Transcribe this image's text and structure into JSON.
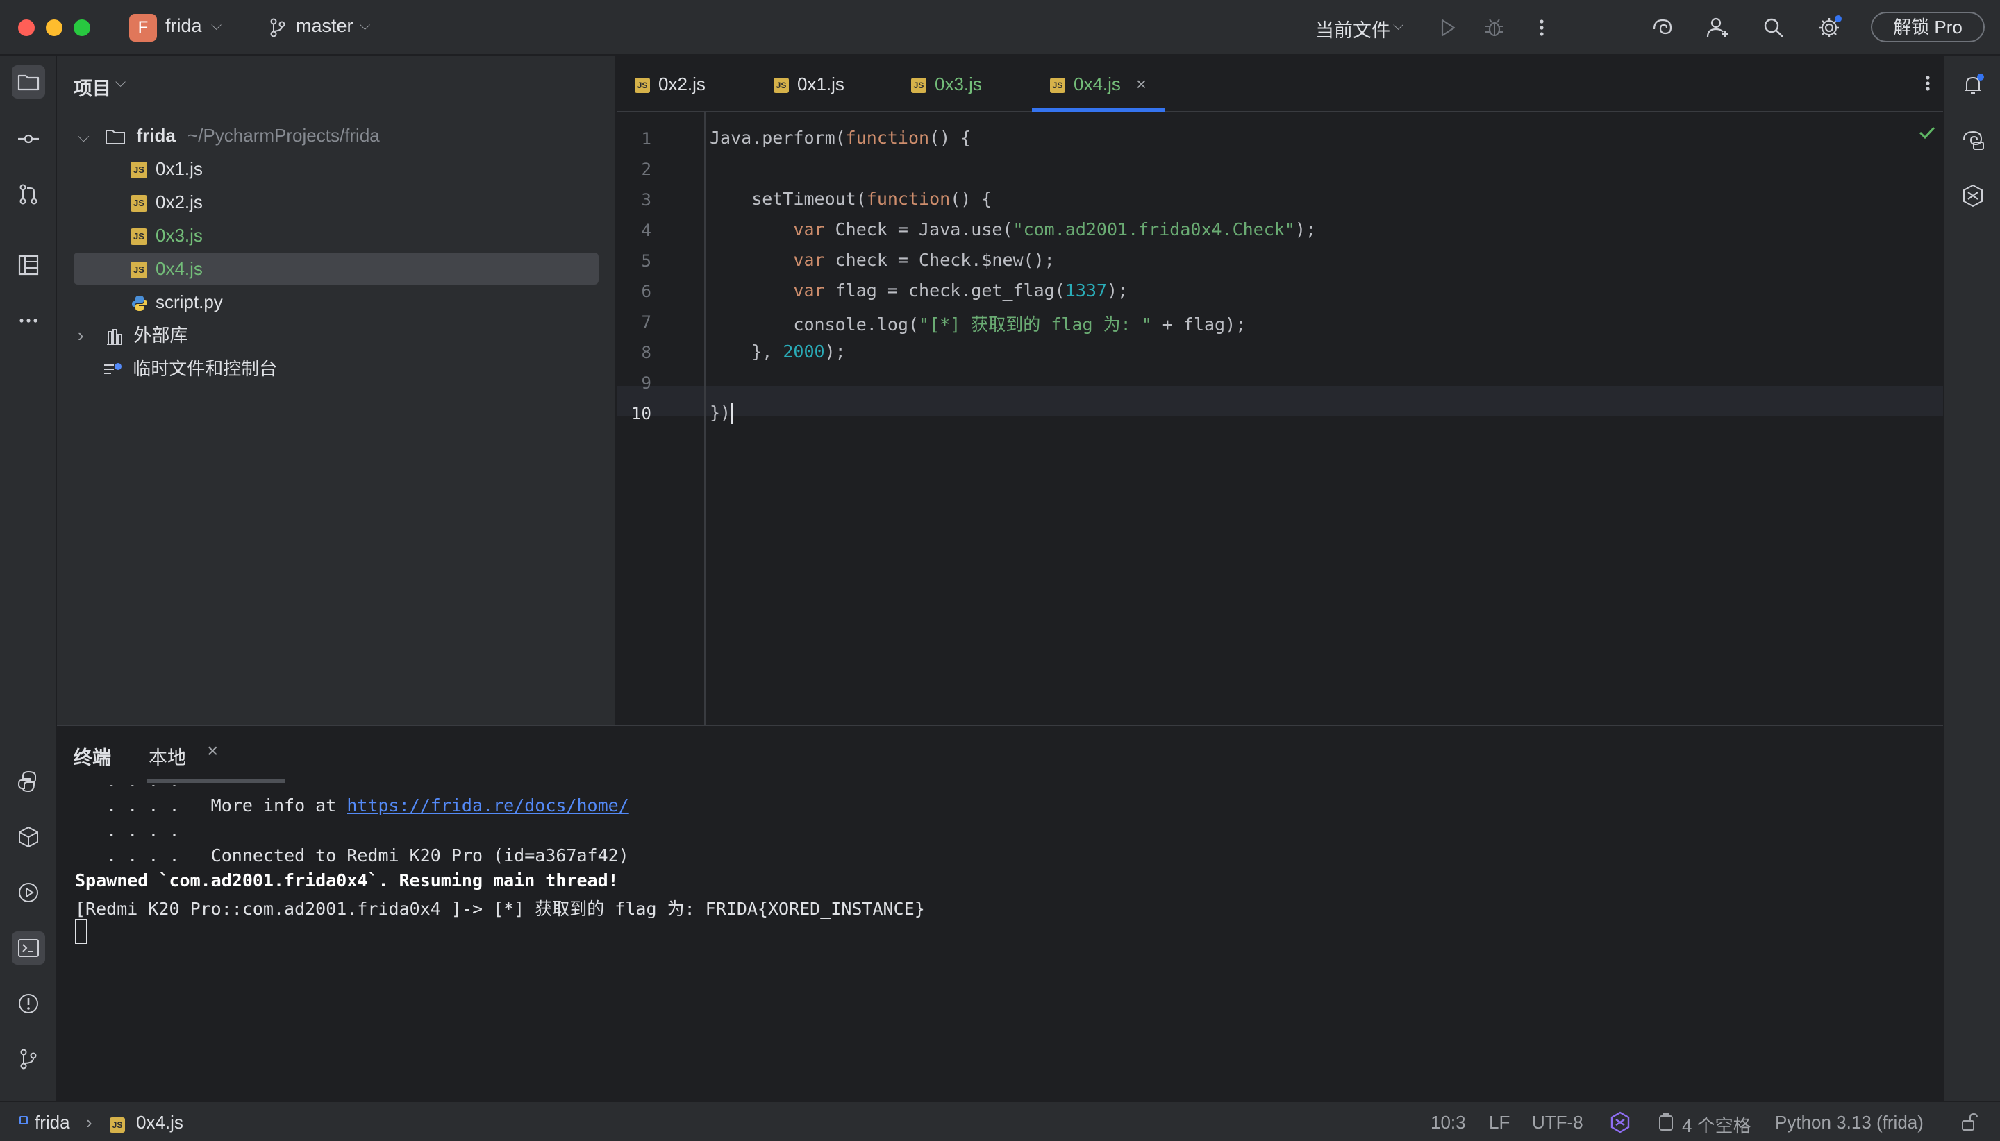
{
  "titlebar": {
    "project_initial": "F",
    "project_name": "frida",
    "branch": "master",
    "run_config": "当前文件",
    "unlock_label": "解锁 Pro"
  },
  "project_panel": {
    "title": "项目",
    "root_name": "frida",
    "root_path": "~/PycharmProjects/frida",
    "files": [
      {
        "name": "0x1.js",
        "color": "#dfe1e5"
      },
      {
        "name": "0x2.js",
        "color": "#dfe1e5"
      },
      {
        "name": "0x3.js",
        "color": "#73bd79"
      },
      {
        "name": "0x4.js",
        "color": "#73bd79"
      },
      {
        "name": "script.py",
        "color": "#dfe1e5"
      }
    ],
    "external_libs": "外部库",
    "scratches": "临时文件和控制台"
  },
  "tabs": [
    {
      "label": "0x2.js"
    },
    {
      "label": "0x1.js"
    },
    {
      "label": "0x3.js"
    },
    {
      "label": "0x4.js"
    }
  ],
  "editor": {
    "line_numbers": [
      "1",
      "2",
      "3",
      "4",
      "5",
      "6",
      "7",
      "8",
      "9",
      "10"
    ]
  },
  "terminal": {
    "tab_title": "终端",
    "session_tab": "本地",
    "dots_0": "   . . . .",
    "more_info_prefix": "   . . . .   More info at ",
    "more_info_link": "https://frida.re/docs/home/",
    "dots_1": "   . . . .",
    "connected": "   . . . .   Connected to Redmi K20 Pro (id=a367af42)",
    "spawned": "Spawned `com.ad2001.frida0x4`. Resuming main thread!",
    "output": "[Redmi K20 Pro::com.ad2001.frida0x4 ]-> [*] 获取到的 flag 为: FRIDA{XORED_INSTANCE}"
  },
  "statusbar": {
    "crumb_project": "frida",
    "crumb_file": "0x4.js",
    "position": "10:3",
    "line_sep": "LF",
    "encoding": "UTF-8",
    "indent": "4 个空格",
    "interpreter": "Python 3.13 (frida)"
  },
  "colors": {
    "accent": "#3574f0",
    "modified_file": "#73bd79",
    "keyword": "#cf8e6d",
    "string": "#6aab73",
    "number": "#2aacb8"
  }
}
